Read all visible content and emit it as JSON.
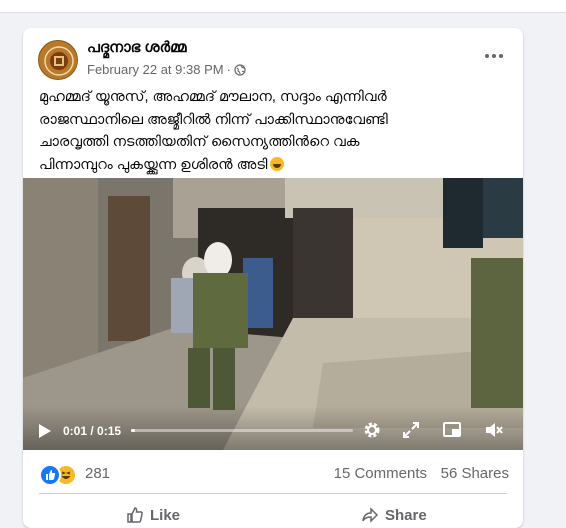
{
  "post": {
    "author": "പദ്മനാഭ ശർമ്മ",
    "date": "February 22 at 9:38 PM",
    "separator": "·",
    "text_lines": [
      "മുഹമ്മദ് യൂനുസ്, അഹമ്മദ് മൗലാന, സദ്ദാം എന്നിവർ",
      "രാജസ്ഥാനിലെ അജ്മീറിൽ നിന്ന് പാക്കിസ്ഥാനുവേണ്ടി",
      "ചാരവൃത്തി നടത്തിയതിന് സൈന്യത്തിൻറെ വക",
      "പിന്നാമ്പുറം പുകയ്ക്കുന്ന ഉശിരൻ അടി"
    ]
  },
  "video": {
    "current_time": "0:01",
    "duration": "0:15",
    "time_separator": " / ",
    "progress": 0.02
  },
  "stats": {
    "reaction_count": "281",
    "comments": "15 Comments",
    "shares": "56 Shares"
  },
  "actions": {
    "like": "Like",
    "share": "Share"
  },
  "colors": {
    "accent": "#1877f2",
    "haha": "#f7b928",
    "muted": "#65676b"
  }
}
